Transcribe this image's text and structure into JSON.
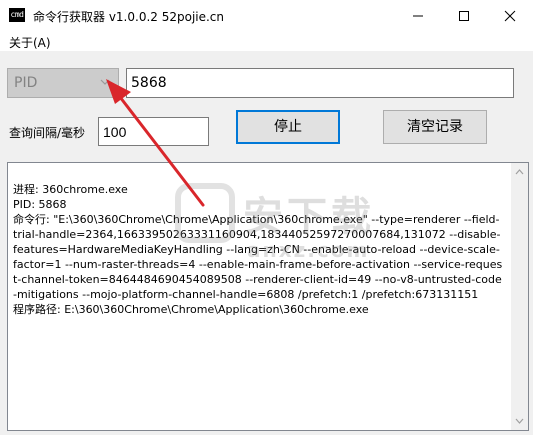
{
  "window": {
    "icon_text": "cmd",
    "title": "命令行获取器 v1.0.0.2   52pojie.cn"
  },
  "menu": {
    "about": "关于(A)"
  },
  "controls": {
    "mode_select": "PID",
    "pid_value": "5868",
    "interval_label": "查询间隔/毫秒",
    "interval_value": "100",
    "stop_label": "停止",
    "clear_label": "清空记录"
  },
  "output": {
    "text": "进程: 360chrome.exe\nPID: 5868\n命令行: \"E:\\360\\360Chrome\\Chrome\\Application\\360chrome.exe\" --type=renderer --field-trial-handle=2364,16633950263331160904,18344052597270007684,131072 --disable-features=HardwareMediaKeyHandling --lang=zh-CN --enable-auto-reload --device-scale-factor=1 --num-raster-threads=4 --enable-main-frame-before-activation --service-request-channel-token=8464484690454089508 --renderer-client-id=49 --no-v8-untrusted-code-mitigations --mojo-platform-channel-handle=6808 /prefetch:1 /prefetch:673131151\n程序路径: E:\\360\\360Chrome\\Chrome\\Application\\360chrome.exe"
  },
  "watermark": {
    "main": "安下载",
    "sub": "anxz.com"
  },
  "colors": {
    "annotation_arrow": "#d9262b",
    "focus_border": "#0078d7"
  },
  "icons": {
    "minimize": "minimize-icon",
    "maximize": "maximize-icon",
    "close": "close-icon",
    "dropdown": "chevron-down-icon"
  }
}
